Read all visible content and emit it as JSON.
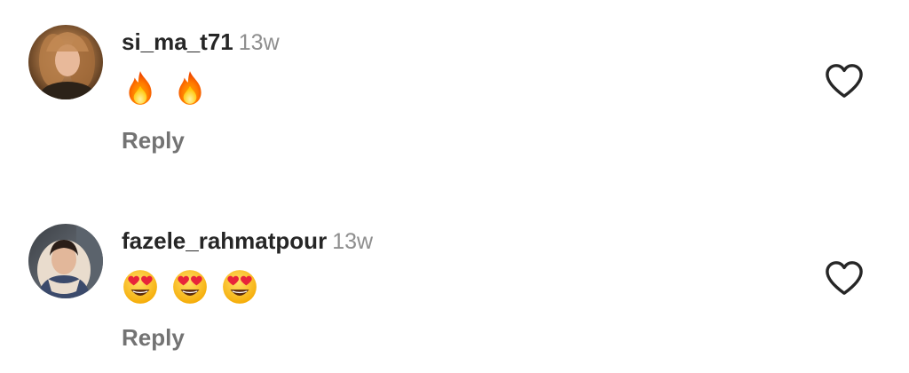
{
  "comments": [
    {
      "username": "si_ma_t71",
      "time": "13w",
      "emojis": [
        "fire-emoji",
        "fire-emoji"
      ],
      "reply_label": "Reply",
      "like_icon": "heart-outline-icon"
    },
    {
      "username": "fazele_rahmatpour",
      "time": "13w",
      "emojis": [
        "heart-eyes-emoji",
        "heart-eyes-emoji",
        "heart-eyes-emoji"
      ],
      "reply_label": "Reply",
      "like_icon": "heart-outline-icon"
    }
  ],
  "colors": {
    "username": "#262626",
    "timestamp": "#8e8e8e",
    "reply": "#737373",
    "heart_outline": "#262626"
  }
}
